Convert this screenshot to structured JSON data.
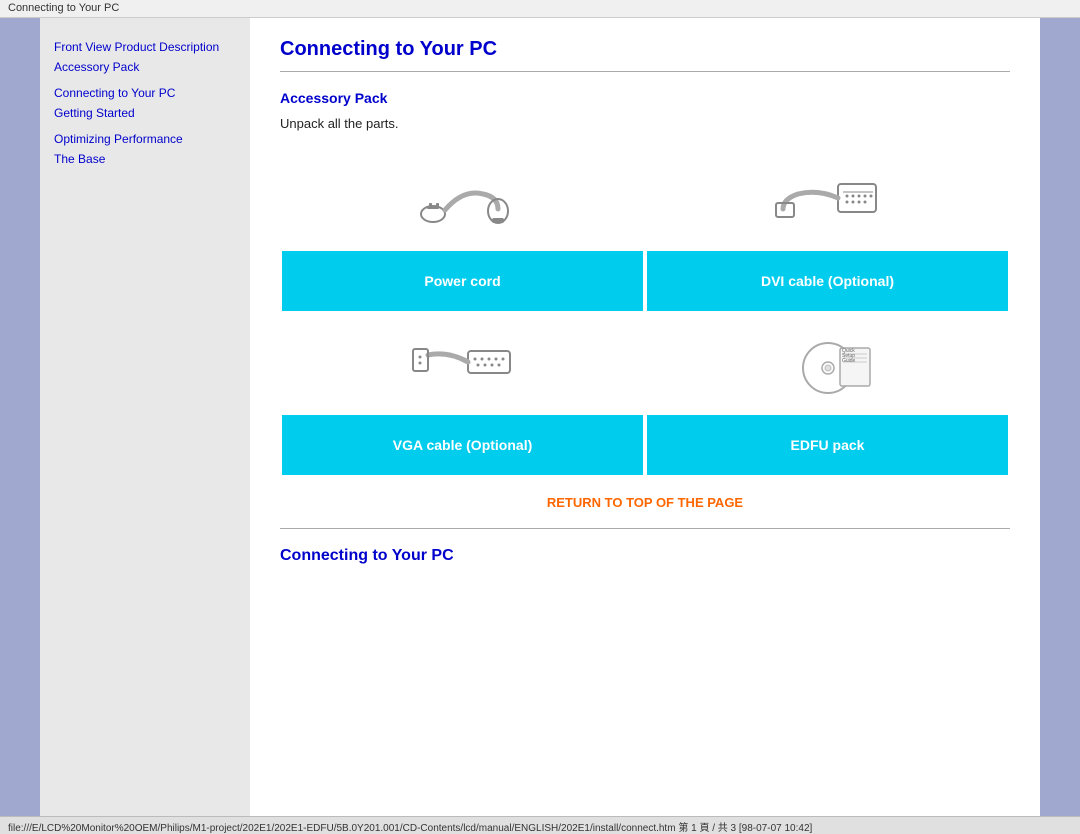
{
  "titleBar": {
    "text": "Connecting to Your PC"
  },
  "sidebar": {
    "links": [
      {
        "label": "Front View Product Description",
        "group": 1
      },
      {
        "label": "Accessory Pack",
        "group": 1
      },
      {
        "label": "Connecting to Your PC",
        "group": 2
      },
      {
        "label": "Getting Started",
        "group": 2
      },
      {
        "label": "Optimizing Performance",
        "group": 3
      },
      {
        "label": "The Base",
        "group": 3
      }
    ]
  },
  "content": {
    "pageTitle": "Connecting to Your PC",
    "section1Title": "Accessory Pack",
    "unpackText": "Unpack all the parts.",
    "items": [
      {
        "label": "Power cord",
        "iconId": "power-cord"
      },
      {
        "label": "DVI cable (Optional)",
        "iconId": "dvi-cable"
      },
      {
        "label": "VGA cable (Optional)",
        "iconId": "vga-cable"
      },
      {
        "label": "EDFU pack",
        "iconId": "edfu-pack"
      }
    ],
    "returnLink": "RETURN TO TOP OF THE PAGE",
    "section2Title": "Connecting to Your PC"
  },
  "statusBar": {
    "text": "file:///E/LCD%20Monitor%20OEM/Philips/M1-project/202E1/202E1-EDFU/5B.0Y201.001/CD-Contents/lcd/manual/ENGLISH/202E1/install/connect.htm 第 1 頁 / 共 3 [98-07-07 10:42]"
  }
}
